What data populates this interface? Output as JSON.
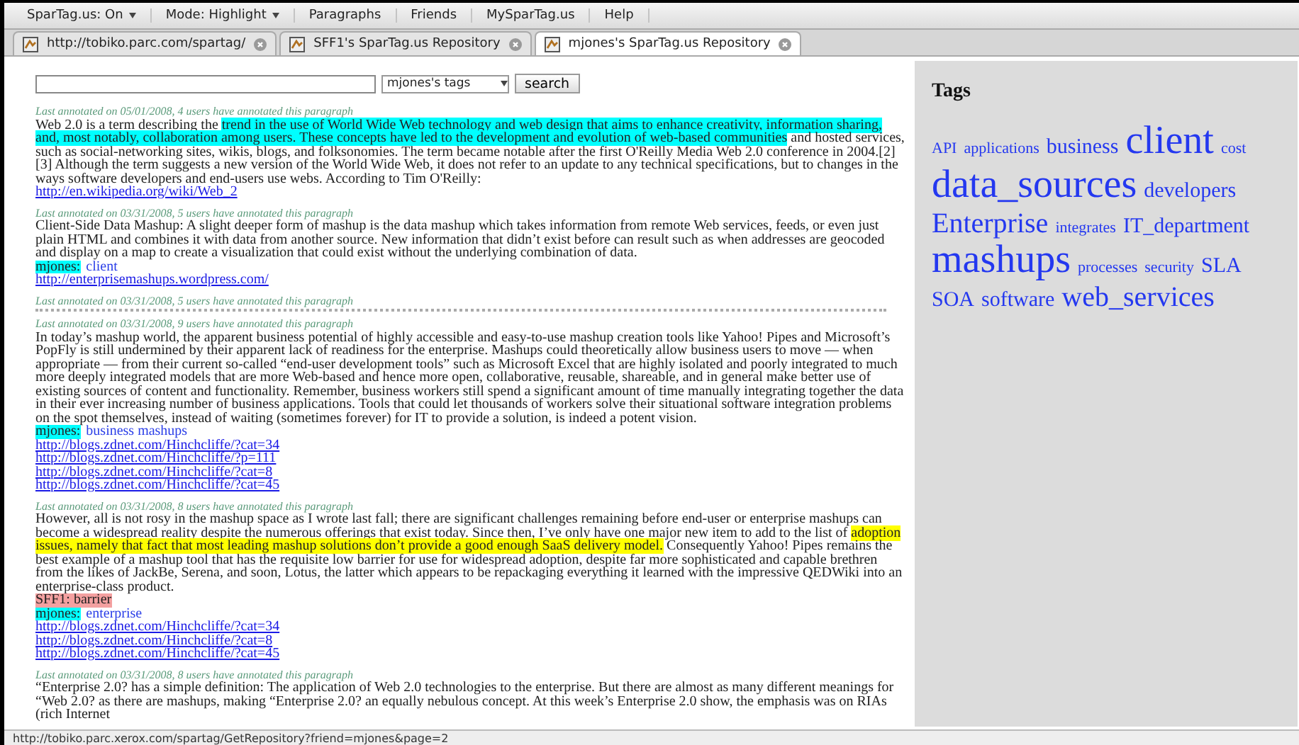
{
  "menu": [
    {
      "label": "SparTag.us: On",
      "dropdown": true
    },
    {
      "label": "Mode: Highlight",
      "dropdown": true
    },
    {
      "label": "Paragraphs",
      "dropdown": false
    },
    {
      "label": "Friends",
      "dropdown": false
    },
    {
      "label": "MySparTag.us",
      "dropdown": false
    },
    {
      "label": "Help",
      "dropdown": false
    }
  ],
  "tabs": [
    {
      "label": "http://tobiko.parc.com/spartag/",
      "selected": false
    },
    {
      "label": "SFF1's SparTag.us Repository",
      "selected": false
    },
    {
      "label": "mjones's SparTag.us Repository",
      "selected": true
    }
  ],
  "search": {
    "select": "mjones's tags",
    "button": "search"
  },
  "paragraphs": [
    {
      "caption": "Last annotated on 05/01/2008, 4 users have annotated this paragraph",
      "collapsed": false,
      "segments": [
        {
          "text": "Web 2.0 is a term describing the "
        },
        {
          "text": "trend in the use of World Wide Web technology and web design that aims to enhance creativity, information sharing, and, most notably, collaboration among users. These concepts have led to the development and evolution of web-based communities",
          "color": "#00ffff"
        },
        {
          "text": " and hosted services, such as social-networking sites, wikis, blogs, and folksonomies. The term became notable after the first O'Reilly Media Web 2.0 conference in 2004.[2][3] Although the term suggests a new version of the World Wide Web, it does not refer to an update to any technical specifications, but to changes in the ways software developers and end-users use webs. According to Tim O'Reilly:"
        }
      ],
      "links": [
        "http://en.wikipedia.org/wiki/Web_2"
      ]
    },
    {
      "caption": "Last annotated on 03/31/2008, 5 users have annotated this paragraph",
      "collapsed": false,
      "segments": [
        {
          "text": "Client-Side Data Mashup: A slight deeper form of mashup is the data mashup which takes information from remote Web services, feeds, or even just plain HTML and combines it with data from another source. New information that didn’t exist before can result such as when addresses are geocoded and display on a map to create a visualization that could exist without the underlying combination of data."
        }
      ],
      "annotations": [
        {
          "kind": "user-tag",
          "user": "mjones:",
          "tags": "client",
          "color": "#00ffff"
        }
      ],
      "links": [
        "http://enterprisemashups.wordpress.com/"
      ]
    },
    {
      "caption": "Last annotated on 03/31/2008, 5 users have annotated this paragraph",
      "collapsed": true
    },
    {
      "caption": "Last annotated on 03/31/2008, 9 users have annotated this paragraph",
      "collapsed": false,
      "segments": [
        {
          "text": "In today’s mashup world, the apparent business potential of highly accessible and easy-to-use mashup creation tools like Yahoo! Pipes and Microsoft’s PopFly is still undermined by their apparent lack of readiness for the enterprise. Mashups could theoretically allow business users to move — when appropriate — from their current so-called “end-user development tools” such as Microsoft Excel that are highly isolated and poorly integrated to much more deeply integrated models that are more Web-based and hence more open, collaborative, reusable, shareable, and in general make better use of existing sources of content and functionality. Remember, business workers still spend a significant amount of time manually integrating together the data in their ever increasing number of business applications. Tools that could let thousands of workers solve their situational software integration problems on the spot themselves, instead of waiting (sometimes forever) for IT to provide a solution, is indeed a potent vision."
        }
      ],
      "annotations": [
        {
          "kind": "user-tag",
          "user": "mjones:",
          "tags": "business mashups",
          "color": "#00ffff"
        }
      ],
      "links": [
        "http://blogs.zdnet.com/Hinchcliffe/?cat=34",
        "http://blogs.zdnet.com/Hinchcliffe/?p=111",
        "http://blogs.zdnet.com/Hinchcliffe/?cat=8",
        "http://blogs.zdnet.com/Hinchcliffe/?cat=45"
      ]
    },
    {
      "caption": "Last annotated on 03/31/2008, 8 users have annotated this paragraph",
      "collapsed": false,
      "segments": [
        {
          "text": "However, all is not rosy in the mashup space as I wrote last fall; there are significant challenges remaining before end-user or enterprise mashups can become a widespread reality despite the numerous offerings that exist today. Since then, I’ve only have one major new item to add to the list of "
        },
        {
          "text": "adoption issues, namely that fact that most leading mashup solutions don’t provide a good enough SaaS delivery model.",
          "color": "#ffff00"
        },
        {
          "text": " Consequently Yahoo! Pipes remains the best example of a mashup tool that has the requisite low barrier for use for widespread adoption, despite far more sophisticated and capable brethren from the likes of JackBe, Serena, and soon, Lotus, the latter which appears to be repackaging everything it learned with the impressive QEDWiki into an enterprise-class product."
        }
      ],
      "annotations": [
        {
          "kind": "note",
          "text": "SFF1: barrier",
          "color": "#f4a0a0"
        },
        {
          "kind": "user-tag",
          "user": "mjones:",
          "tags": "enterprise",
          "color": "#00ffff"
        }
      ],
      "links": [
        "http://blogs.zdnet.com/Hinchcliffe/?cat=34",
        "http://blogs.zdnet.com/Hinchcliffe/?cat=8",
        "http://blogs.zdnet.com/Hinchcliffe/?cat=45"
      ]
    },
    {
      "caption": "Last annotated on 03/31/2008, 8 users have annotated this paragraph",
      "collapsed": false,
      "segments": [
        {
          "text": "“Enterprise 2.0? has a simple definition: The application of Web 2.0 technologies to the enterprise. But there are almost as many different meanings for “Web 2.0? as there are mashups, making “Enterprise 2.0? an equally nebulous concept. At this week’s Enterprise 2.0 show, the emphasis was on RIAs (rich Internet"
        }
      ]
    }
  ],
  "tags_panel": {
    "title": "Tags",
    "tags": [
      {
        "label": "API",
        "kind": "small"
      },
      {
        "label": "applications",
        "kind": "small"
      },
      {
        "label": "business",
        "kind": "medium"
      },
      {
        "label": "client",
        "kind": "huge"
      },
      {
        "label": "cost",
        "kind": "small"
      },
      {
        "label": "data_sources",
        "kind": "huge"
      },
      {
        "label": "developers",
        "kind": "medium"
      },
      {
        "label": "Enterprise",
        "kind": "large"
      },
      {
        "label": "integrates",
        "kind": "small"
      },
      {
        "label": "IT_department",
        "kind": "medium"
      },
      {
        "label": "mashups",
        "kind": "huge"
      },
      {
        "label": "processes",
        "kind": "small"
      },
      {
        "label": "security",
        "kind": "small"
      },
      {
        "label": "SLA",
        "kind": "medium"
      },
      {
        "label": "SOA",
        "kind": "medium"
      },
      {
        "label": "software",
        "kind": "medium"
      },
      {
        "label": "web_services",
        "kind": "large"
      }
    ]
  },
  "status_bar": "http://tobiko.parc.xerox.com/spartag/GetRepository?friend=mjones&page=2"
}
